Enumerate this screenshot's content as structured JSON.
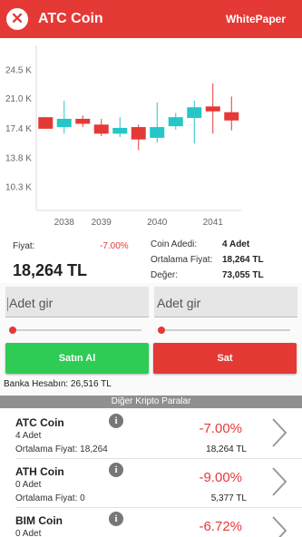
{
  "header": {
    "close_symbol": "✕",
    "title": "ATC Coin",
    "whitepaper_label": "WhitePaper"
  },
  "chart_data": {
    "type": "candlestick",
    "y_ticks": [
      "24.5 K",
      "21.0 K",
      "17.4 K",
      "13.8 K",
      "10.3 K"
    ],
    "y_tick_values": [
      24500,
      21000,
      17400,
      13800,
      10300
    ],
    "x_ticks": [
      "2038",
      "2039",
      "2040",
      "2041"
    ],
    "x_tick_positions": [
      1,
      3,
      6,
      9
    ],
    "ylim": [
      7500,
      27500
    ],
    "grid": "y-axis lines",
    "candles": [
      {
        "open": 17400,
        "close": 18800,
        "high": 18800,
        "low": 17400,
        "color": "#e53935"
      },
      {
        "open": 17600,
        "close": 18600,
        "high": 20800,
        "low": 16800,
        "color": "#26c6c6"
      },
      {
        "open": 18600,
        "close": 18000,
        "high": 19000,
        "low": 17600,
        "color": "#e53935"
      },
      {
        "open": 17900,
        "close": 16800,
        "high": 18600,
        "low": 16500,
        "color": "#e53935"
      },
      {
        "open": 16800,
        "close": 17500,
        "high": 18800,
        "low": 16400,
        "color": "#26c6c6"
      },
      {
        "open": 17600,
        "close": 16100,
        "high": 17900,
        "low": 14800,
        "color": "#e53935"
      },
      {
        "open": 16300,
        "close": 17600,
        "high": 20600,
        "low": 15700,
        "color": "#26c6c6"
      },
      {
        "open": 17700,
        "close": 18800,
        "high": 19300,
        "low": 17300,
        "color": "#26c6c6"
      },
      {
        "open": 18700,
        "close": 20000,
        "high": 20800,
        "low": 15600,
        "color": "#26c6c6"
      },
      {
        "open": 20100,
        "close": 19500,
        "high": 22900,
        "low": 16800,
        "color": "#e53935"
      },
      {
        "open": 19400,
        "close": 18400,
        "high": 21300,
        "low": 17200,
        "color": "#e53935"
      }
    ]
  },
  "info": {
    "price_label": "Fiyat:",
    "change": "-7.00%",
    "price": "18,264 TL",
    "stats": [
      {
        "key": "Coin Adedi:",
        "value": "4 Adet"
      },
      {
        "key": "Ortalama Fiyat:",
        "value": "18,264 TL"
      },
      {
        "key": "Değer:",
        "value": "73,055 TL"
      }
    ]
  },
  "buy": {
    "placeholder": "Adet gir",
    "button": "Satın Al",
    "button_color": "#2ecc55",
    "slider": 0
  },
  "sell": {
    "placeholder": "Adet gir",
    "button": "Sat",
    "button_color": "#e53935",
    "slider": 0
  },
  "bank": "Banka Hesabın: 26,516 TL",
  "section_title": "Diğer Kripto Paralar",
  "coins": [
    {
      "name": "ATC Coin",
      "info": "i",
      "amount": "4 Adet",
      "avg": "Ortalama Fiyat: 18,264",
      "change": "-7.00%",
      "value": "18,264 TL"
    },
    {
      "name": "ATH Coin",
      "info": "i",
      "amount": "0 Adet",
      "avg": "Ortalama Fiyat: 0",
      "change": "-9.00%",
      "value": "5,377 TL"
    },
    {
      "name": "BIM Coin",
      "info": "i",
      "amount": "0 Adet",
      "avg": "",
      "change": "-6.72%",
      "value": ""
    }
  ]
}
